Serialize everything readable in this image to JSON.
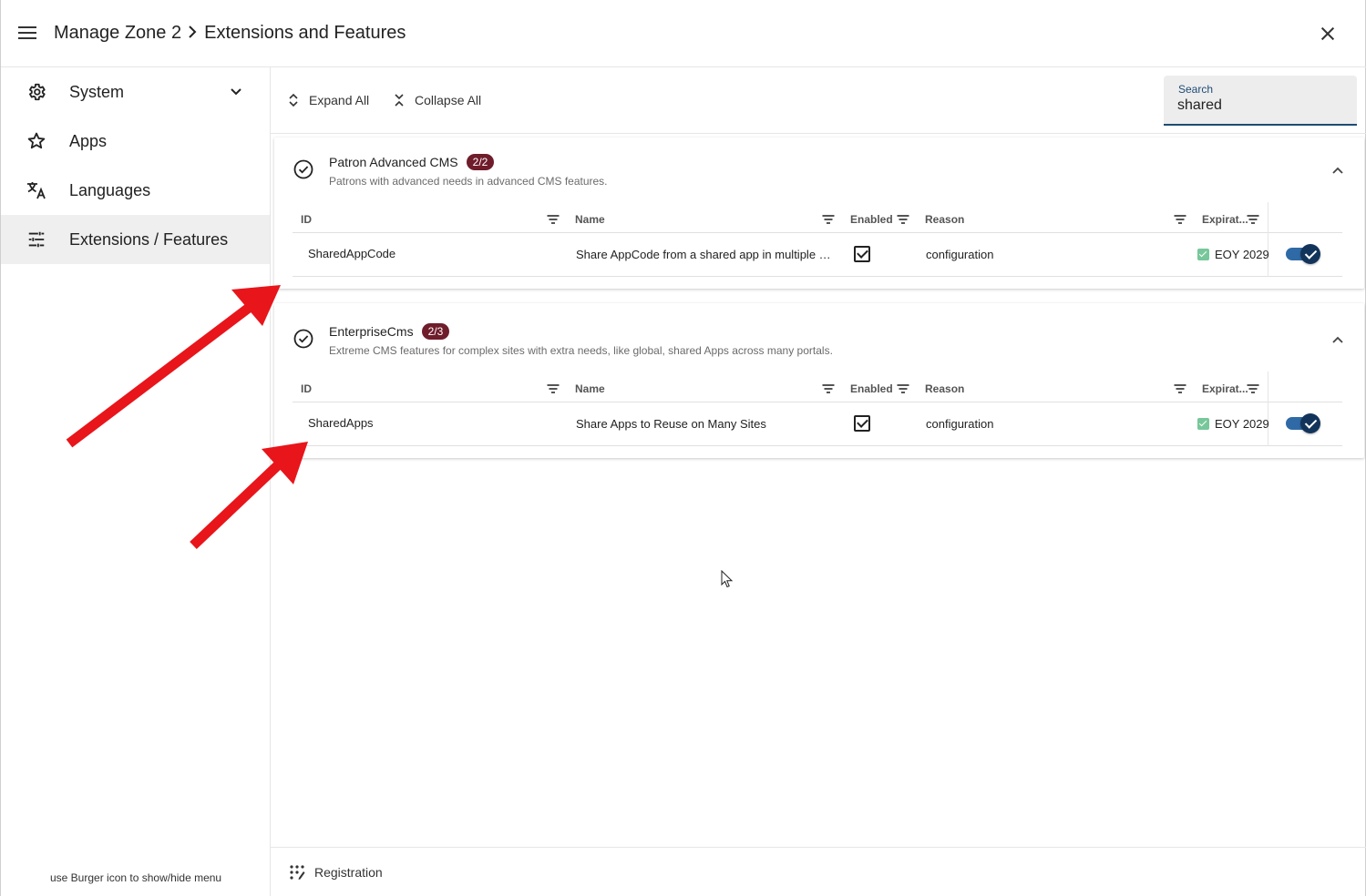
{
  "header": {
    "title_part1": "Manage Zone 2",
    "title_part2": "Extensions and Features"
  },
  "sidebar": {
    "items": [
      {
        "label": "System",
        "icon": "gear-icon",
        "has_chevron": true
      },
      {
        "label": "Apps",
        "icon": "star-icon"
      },
      {
        "label": "Languages",
        "icon": "translate-icon"
      },
      {
        "label": "Extensions / Features",
        "icon": "tune-icon",
        "active": true
      }
    ],
    "hint": "use Burger icon to show/hide menu"
  },
  "toolbar": {
    "expand_all": "Expand All",
    "collapse_all": "Collapse All",
    "search_label": "Search",
    "search_value": "shared"
  },
  "columns": {
    "id": "ID",
    "name": "Name",
    "enabled": "Enabled",
    "reason": "Reason",
    "expiration": "Expirat..."
  },
  "panels": [
    {
      "title": "Patron Advanced CMS",
      "badge": "2/2",
      "description": "Patrons with advanced needs in advanced CMS features.",
      "rows": [
        {
          "id": "SharedAppCode",
          "name": "Share AppCode from a shared app in multiple sites",
          "enabled": true,
          "reason": "configuration",
          "expiration": "EOY 2029",
          "toggle_on": true
        }
      ]
    },
    {
      "title": "EnterpriseCms",
      "badge": "2/3",
      "description": "Extreme CMS features for complex sites with extra needs, like global, shared Apps across many portals.",
      "rows": [
        {
          "id": "SharedApps",
          "name": "Share Apps to Reuse on Many Sites",
          "enabled": true,
          "reason": "configuration",
          "expiration": "EOY 2029",
          "toggle_on": true
        }
      ]
    }
  ],
  "footer": {
    "registration": "Registration"
  },
  "colors": {
    "badge": "#6f1d2b",
    "accent": "#1e4b75",
    "toggle_track": "#2f6aa6",
    "annotation_arrow": "#e8151b"
  }
}
